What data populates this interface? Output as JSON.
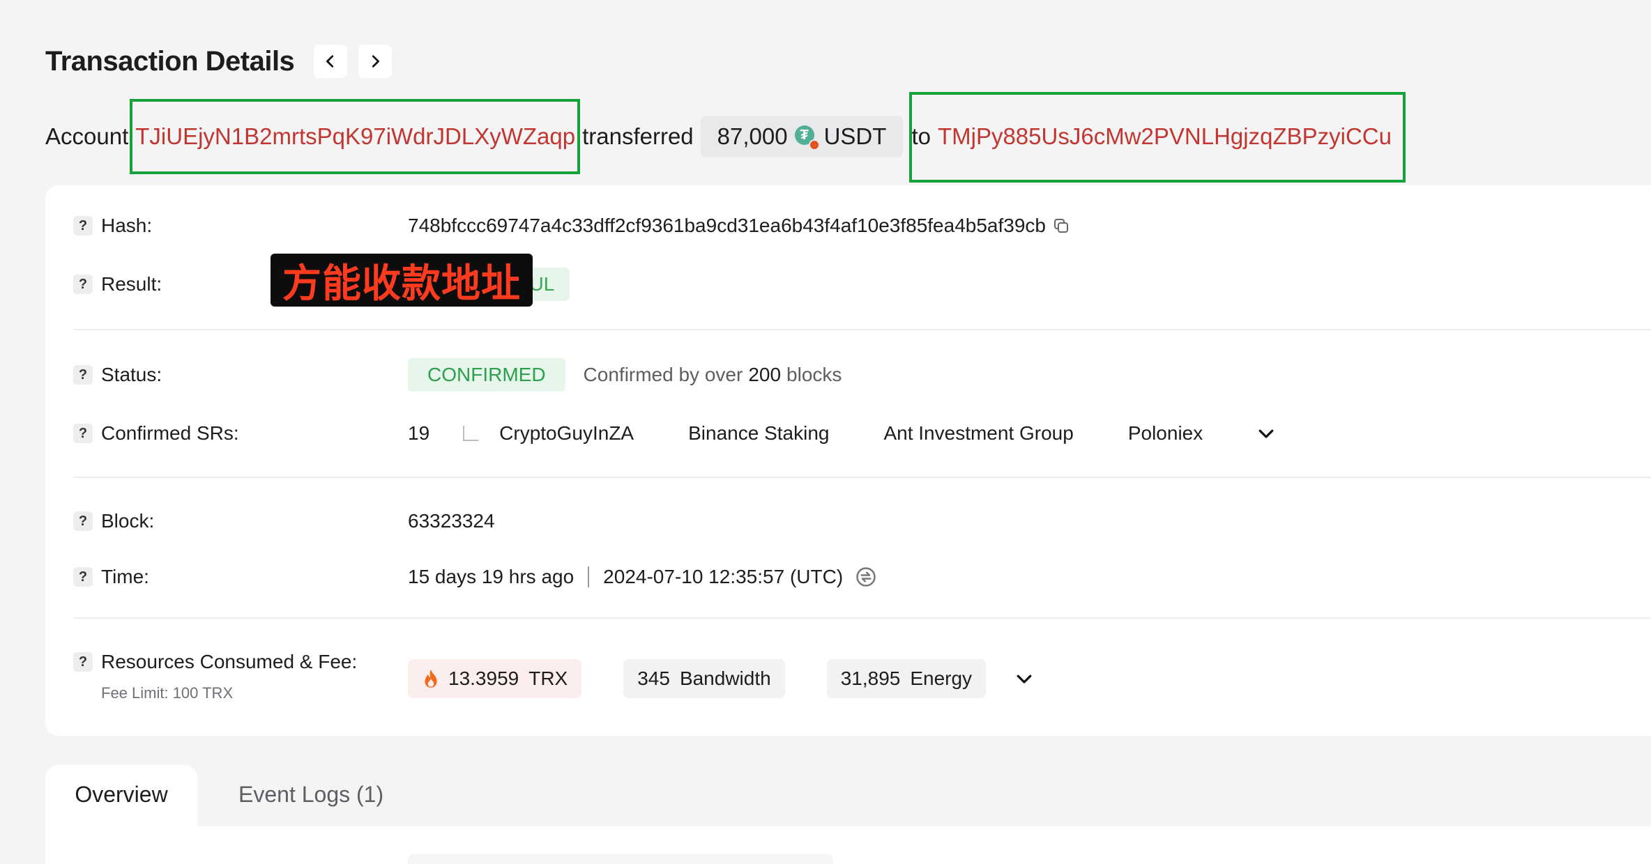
{
  "header": {
    "title": "Transaction Details"
  },
  "transfer": {
    "prefix": "Account",
    "from_address": "TJiUEjyN1B2mrtsPqK97iWdrJDLXyWZaqp",
    "verb": "transferred",
    "amount": "87,000",
    "token": "USDT",
    "to_word": "to",
    "to_address": "TMjPy885UsJ6cMw2PVNLHgjzqZBPzyiCCu"
  },
  "overlay": {
    "text": "方能收款地址"
  },
  "details": {
    "hash": {
      "label": "Hash:",
      "value": "748bfccc69747a4c33dff2cf9361ba9cd31ea6b43f4af10e3f85fea4b5af39cb"
    },
    "result": {
      "label": "Result:",
      "value": "SUCCESSFUL"
    },
    "status": {
      "label": "Status:",
      "value": "CONFIRMED",
      "note_prefix": "Confirmed by over",
      "note_count": "200",
      "note_suffix": "blocks"
    },
    "confirmed_srs": {
      "label": "Confirmed SRs:",
      "count": "19",
      "items": [
        "CryptoGuyInZA",
        "Binance Staking",
        "Ant Investment Group",
        "Poloniex"
      ]
    },
    "block": {
      "label": "Block:",
      "value": "63323324"
    },
    "time": {
      "label": "Time:",
      "relative": "15 days 19 hrs ago",
      "absolute": "2024-07-10 12:35:57 (UTC)"
    },
    "resources": {
      "label": "Resources Consumed & Fee:",
      "fee_limit": "Fee Limit: 100 TRX",
      "trx_amount": "13.3959",
      "trx_unit": "TRX",
      "bandwidth_amount": "345",
      "bandwidth_unit": "Bandwidth",
      "energy_amount": "31,895",
      "energy_unit": "Energy"
    }
  },
  "tabs": {
    "overview": "Overview",
    "event_logs": "Event Logs (1)"
  },
  "icons": {
    "prev": "chevron-left-icon",
    "next": "chevron-right-icon",
    "token": "usdt-icon",
    "copy": "copy-icon",
    "expand": "chevron-down-icon",
    "time_toggle": "clock-switch-icon",
    "fee": "flame-icon"
  },
  "colors": {
    "address": "#c23631",
    "success": "#39a754",
    "highlight_box": "#14a33a",
    "usdt": "#50af95",
    "overlay_text": "#ff3b1f"
  }
}
